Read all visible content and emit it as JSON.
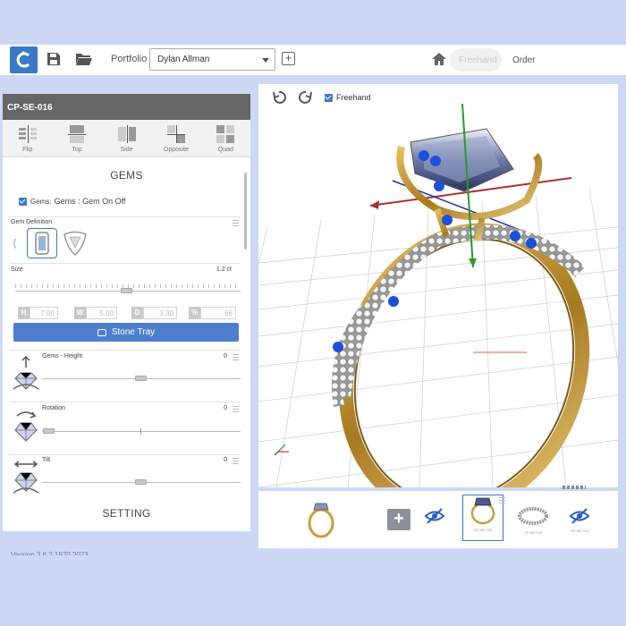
{
  "toolbar": {
    "portfolio_label": "Portfolio",
    "portfolio_value": "Dylan Allman",
    "tabs": [
      {
        "label": "Freehand",
        "state": "disabled"
      },
      {
        "label": "Order",
        "state": "normal"
      }
    ]
  },
  "left_panel": {
    "design_id": "CP-SE-016",
    "symmetry": [
      "Flip",
      "Top",
      "Side",
      "Opposite",
      "Quad"
    ],
    "gems_title": "GEMS",
    "gems_toggle": {
      "prefix": "Gems:",
      "label": "Gems : Gem On Off",
      "checked": true
    },
    "gem_definition_label": "Gem Definition",
    "size": {
      "label": "Size",
      "value": "1.2 ct"
    },
    "dimensions": [
      {
        "key": "H",
        "value": "7.00"
      },
      {
        "key": "W",
        "value": "5.00"
      },
      {
        "key": "D",
        "value": "3.30"
      },
      {
        "key": "%",
        "value": "66"
      }
    ],
    "stone_tray_label": "Stone Tray",
    "adjustments": [
      {
        "label": "Gems - Height",
        "value": "0"
      },
      {
        "label": "Rotation",
        "value": "0"
      },
      {
        "label": "Tilt",
        "value": "0"
      }
    ],
    "setting_title": "SETTING"
  },
  "viewport": {
    "freehand_label": "Freehand",
    "freehand_checked": true
  },
  "thumbnails": [
    {
      "caption": "CP-SE-016"
    },
    {
      "caption": "CP-SE-016"
    },
    {
      "caption": "CP-SE-016"
    }
  ],
  "version": "Version 3.6.2.1970.2023",
  "colors": {
    "accent": "#3a79c8",
    "button": "#4d7fcc",
    "background": "#cdd9f4",
    "gold": "#c8a040"
  }
}
